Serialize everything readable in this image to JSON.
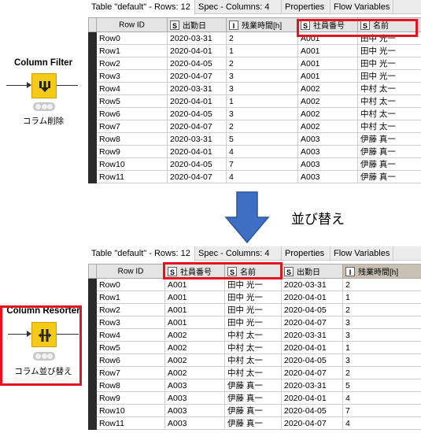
{
  "colors": {
    "node_yellow": "#f5cb18",
    "highlight_red": "#e2141e",
    "arrow_blue": "#3e6fc4"
  },
  "top_node": {
    "title": "Column Filter",
    "label": "コラム削除",
    "icon": "column-filter-icon"
  },
  "bottom_node": {
    "title": "Column Resorter",
    "label": "コラム並び替え",
    "icon": "column-resorter-icon"
  },
  "arrow_caption": "並び替え",
  "top_table": {
    "tabs": [
      "Table \"default\" - Rows: 12",
      "Spec - Columns: 4",
      "Properties",
      "Flow Variables"
    ],
    "headers": [
      {
        "type": "",
        "name": "Row ID"
      },
      {
        "type": "S",
        "name": "出勤日"
      },
      {
        "type": "I",
        "name": "残業時間[h]"
      },
      {
        "type": "S",
        "name": "社員番号"
      },
      {
        "type": "S",
        "name": "名前"
      }
    ],
    "rows": [
      [
        "Row0",
        "2020-03-31",
        "2",
        "A001",
        "田中 光一"
      ],
      [
        "Row1",
        "2020-04-01",
        "1",
        "A001",
        "田中 光一"
      ],
      [
        "Row2",
        "2020-04-05",
        "2",
        "A001",
        "田中 光一"
      ],
      [
        "Row3",
        "2020-04-07",
        "3",
        "A001",
        "田中 光一"
      ],
      [
        "Row4",
        "2020-03-31",
        "3",
        "A002",
        "中村 太一"
      ],
      [
        "Row5",
        "2020-04-01",
        "1",
        "A002",
        "中村 太一"
      ],
      [
        "Row6",
        "2020-04-05",
        "3",
        "A002",
        "中村 太一"
      ],
      [
        "Row7",
        "2020-04-07",
        "2",
        "A002",
        "中村 太一"
      ],
      [
        "Row8",
        "2020-03-31",
        "5",
        "A003",
        "伊藤 真一"
      ],
      [
        "Row9",
        "2020-04-01",
        "4",
        "A003",
        "伊藤 真一"
      ],
      [
        "Row10",
        "2020-04-05",
        "7",
        "A003",
        "伊藤 真一"
      ],
      [
        "Row11",
        "2020-04-07",
        "4",
        "A003",
        "伊藤 真一"
      ]
    ]
  },
  "bottom_table": {
    "tabs": [
      "Table \"default\" - Rows: 12",
      "Spec - Columns: 4",
      "Properties",
      "Flow Variables"
    ],
    "headers": [
      {
        "type": "",
        "name": "Row ID"
      },
      {
        "type": "S",
        "name": "社員番号"
      },
      {
        "type": "S",
        "name": "名前"
      },
      {
        "type": "S",
        "name": "出勤日"
      },
      {
        "type": "I",
        "name": "残業時間[h]"
      }
    ],
    "rows": [
      [
        "Row0",
        "A001",
        "田中 光一",
        "2020-03-31",
        "2"
      ],
      [
        "Row1",
        "A001",
        "田中 光一",
        "2020-04-01",
        "1"
      ],
      [
        "Row2",
        "A001",
        "田中 光一",
        "2020-04-05",
        "2"
      ],
      [
        "Row3",
        "A001",
        "田中 光一",
        "2020-04-07",
        "3"
      ],
      [
        "Row4",
        "A002",
        "中村 太一",
        "2020-03-31",
        "3"
      ],
      [
        "Row5",
        "A002",
        "中村 太一",
        "2020-04-01",
        "1"
      ],
      [
        "Row6",
        "A002",
        "中村 太一",
        "2020-04-05",
        "3"
      ],
      [
        "Row7",
        "A002",
        "中村 太一",
        "2020-04-07",
        "2"
      ],
      [
        "Row8",
        "A003",
        "伊藤 真一",
        "2020-03-31",
        "5"
      ],
      [
        "Row9",
        "A003",
        "伊藤 真一",
        "2020-04-01",
        "4"
      ],
      [
        "Row10",
        "A003",
        "伊藤 真一",
        "2020-04-05",
        "7"
      ],
      [
        "Row11",
        "A003",
        "伊藤 真一",
        "2020-04-07",
        "4"
      ]
    ]
  }
}
